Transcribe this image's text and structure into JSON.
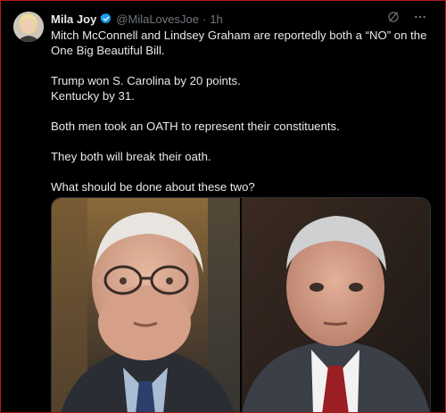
{
  "post": {
    "author_name": "Mila Joy",
    "handle": "@MilaLovesJoe",
    "separator": "·",
    "time": "1h",
    "lines": [
      "Mitch McConnell and Lindsey Graham are reportedly both a “NO” on the One Big Beautiful Bill.",
      "Trump won S. Carolina by 20 points.",
      "Kentucky by 31.",
      "Both men took an OATH to represent their constituents.",
      "They both will break their oath.",
      "What should be done about these two?"
    ]
  },
  "icons": {
    "verified": "verified-badge-icon",
    "grok": "grok-icon",
    "more": "more-options-icon"
  },
  "colors": {
    "background": "#000000",
    "text": "#e7e9ea",
    "secondary_text": "#71767b",
    "verified_blue": "#1d9bf0",
    "frame_border": "#b11a1a"
  }
}
